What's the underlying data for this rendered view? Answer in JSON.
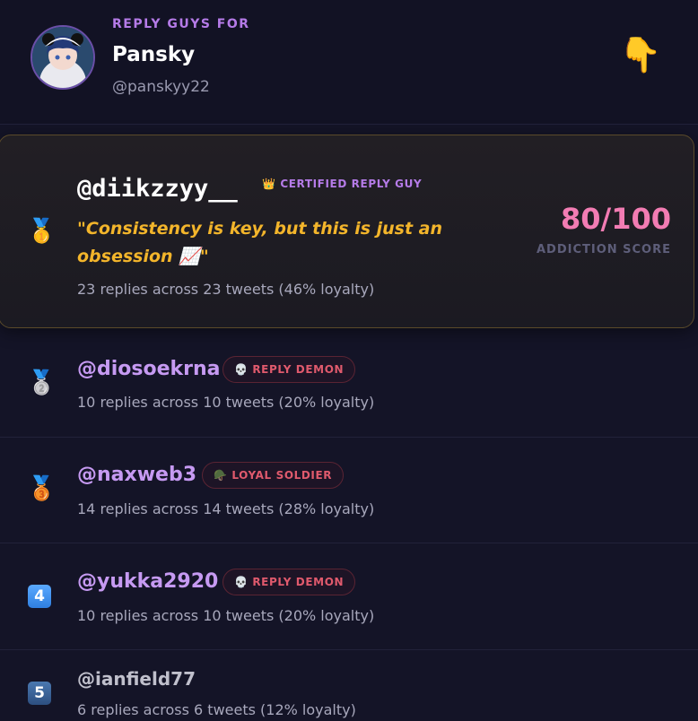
{
  "header": {
    "eyebrow": "REPLY GUYS FOR",
    "name": "Pansky",
    "handle": "@panskyy22",
    "pointer_icon": "👇"
  },
  "entries": [
    {
      "rank_icon": "🥇",
      "username": "@diikzzyy__",
      "badge_icon": "👑",
      "badge": "CERTIFIED REPLY GUY",
      "quote": "\"Consistency is key, but this is just an obsession 📈\"",
      "stats": "23 replies across 23 tweets (46% loyalty)",
      "score": "80/100",
      "score_label": "ADDICTION SCORE"
    },
    {
      "rank_icon": "🥈",
      "username": "@diosoekrna",
      "badge_icon": "💀",
      "badge": "REPLY DEMON",
      "stats": "10 replies across 10 tweets (20% loyalty)"
    },
    {
      "rank_icon": "🥉",
      "username": "@naxweb3",
      "badge_icon": "🪖",
      "badge": "LOYAL SOLDIER",
      "stats": "14 replies across 14 tweets (28% loyalty)"
    },
    {
      "rank_icon": "4",
      "username": "@yukka2920",
      "badge_icon": "💀",
      "badge": "REPLY DEMON",
      "stats": "10 replies across 10 tweets (20% loyalty)"
    },
    {
      "rank_icon": "5",
      "username": "@ianfield77",
      "stats": "6 replies across 6 tweets (12% loyalty)"
    }
  ],
  "colors": {
    "accent_purple": "#b57be8",
    "score_pink": "#f27cb3",
    "quote_gold": "#f3b52b",
    "demon_red": "#e05a6d"
  }
}
